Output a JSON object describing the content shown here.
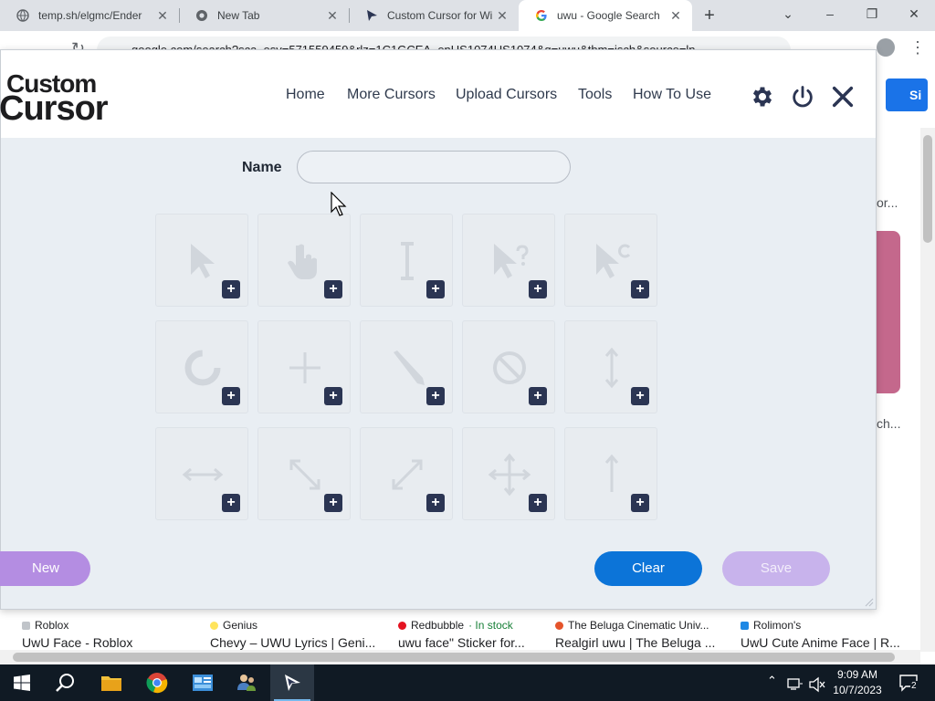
{
  "browser": {
    "tabs": [
      {
        "title": "temp.sh/elgmc/Ender",
        "favicon": "globe-icon"
      },
      {
        "title": "New Tab",
        "favicon": "chrome-icon"
      },
      {
        "title": "Custom Cursor for Wi",
        "favicon": "custom-cursor-logo-icon"
      },
      {
        "title": "uwu - Google Search",
        "favicon": "google-icon"
      }
    ],
    "active_tab": 3,
    "address": "google.com/search?sca_esv=571559459&rlz=1C1GCEA_enUS1074US1074&q=uwu&tbm=isch&source=ln"
  },
  "google_page": {
    "sign_in_label": "Si",
    "snippet_1": "or...",
    "snippet_2": "ch...",
    "results": [
      {
        "source": "Roblox",
        "title": "UwU Face - Roblox",
        "stock": ""
      },
      {
        "source": "Genius",
        "title": "Chevy – UWU Lyrics | Geni...",
        "stock": ""
      },
      {
        "source": "Redbubble",
        "stock": "· In stock",
        "title": "uwu face\" Sticker for..."
      },
      {
        "source": "The Beluga Cinematic Univ...",
        "title": "Realgirl uwu | The Beluga ...",
        "stock": ""
      },
      {
        "source": "Rolimon's",
        "title": "UwU Cute Anime Face | R...",
        "stock": ""
      }
    ]
  },
  "popup": {
    "logo_line1": "Custom",
    "logo_line2": "Cursor",
    "nav": [
      "Home",
      "More Cursors",
      "Upload Cursors",
      "Tools",
      "How To Use"
    ],
    "name_label": "Name",
    "name_value": "",
    "cells": [
      {
        "icon": "arrow-pointer-icon"
      },
      {
        "icon": "hand-pointer-icon"
      },
      {
        "icon": "text-ibeam-icon"
      },
      {
        "icon": "help-pointer-icon"
      },
      {
        "icon": "working-pointer-icon"
      },
      {
        "icon": "busy-spinner-icon"
      },
      {
        "icon": "crosshair-icon"
      },
      {
        "icon": "pen-icon"
      },
      {
        "icon": "not-allowed-icon"
      },
      {
        "icon": "resize-vertical-icon"
      },
      {
        "icon": "resize-horizontal-icon"
      },
      {
        "icon": "resize-diagonal-nwse-icon"
      },
      {
        "icon": "resize-diagonal-nesw-icon"
      },
      {
        "icon": "move-icon"
      },
      {
        "icon": "up-arrow-icon"
      }
    ],
    "plus_label": "+",
    "buttons": {
      "new": "New",
      "clear": "Clear",
      "save": "Save"
    },
    "colors": {
      "new": "#b48de2",
      "clear": "#0c74d8",
      "save": "#c8b3ec",
      "plus": "#2b3553"
    }
  },
  "taskbar": {
    "time": "9:09 AM",
    "date": "10/7/2023",
    "notification_count": "2"
  }
}
